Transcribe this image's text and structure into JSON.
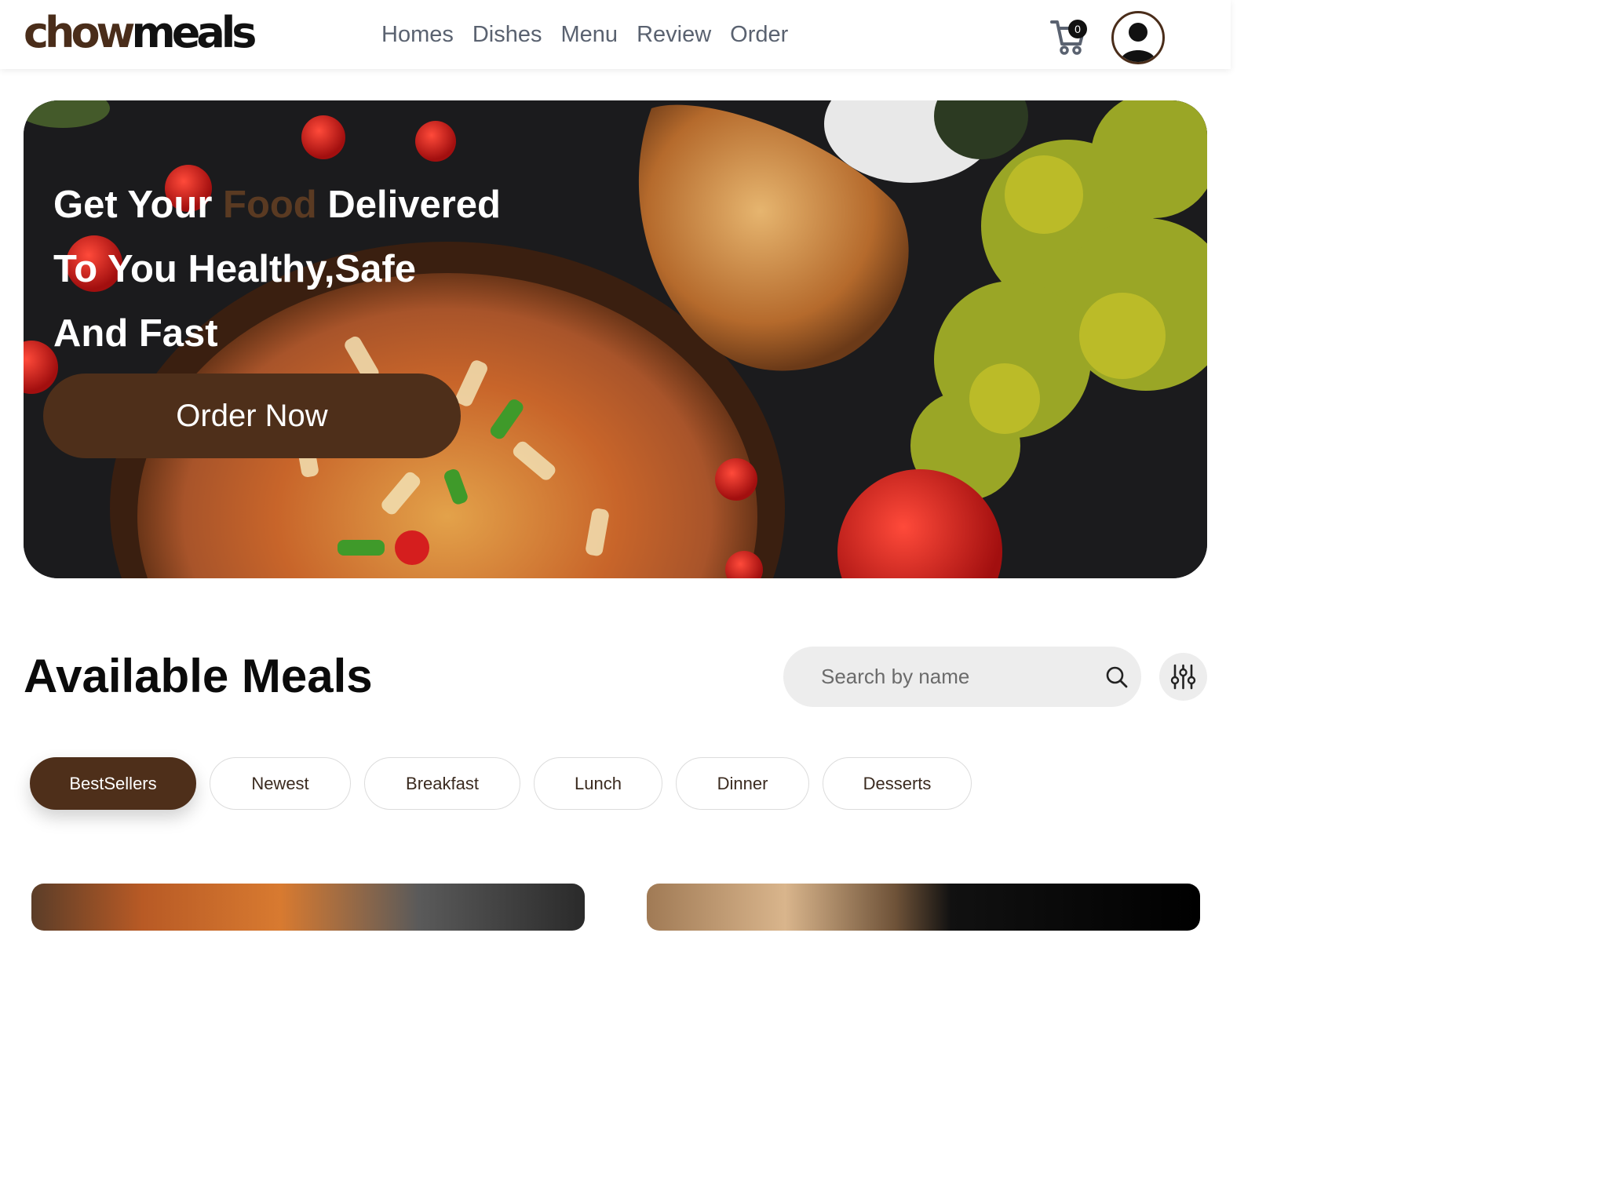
{
  "header": {
    "logo": {
      "part1": "chow",
      "part2": "meals"
    },
    "nav": [
      "Homes",
      "Dishes",
      "Menu",
      "Review",
      "Order"
    ],
    "cart_count": "0"
  },
  "hero": {
    "line1_a": "Get Your ",
    "line1_accent": "Food",
    "line1_b": " Delivered",
    "line2": "To You Healthy,Safe",
    "line3": "And Fast",
    "cta": "Order Now",
    "accent_color": "#5a3a22"
  },
  "meals": {
    "title": "Available Meals",
    "search_placeholder": "Search by name",
    "categories": [
      "BestSellers",
      "Newest",
      "Breakfast",
      "Lunch",
      "Dinner",
      "Desserts"
    ],
    "active_category": "BestSellers"
  },
  "colors": {
    "brand": "#4e2f1a",
    "nav_text": "#5a6270",
    "chip_bg": "#ededed"
  },
  "icons": [
    "cart-icon",
    "user-avatar-icon",
    "search-icon",
    "filter-sliders-icon"
  ]
}
